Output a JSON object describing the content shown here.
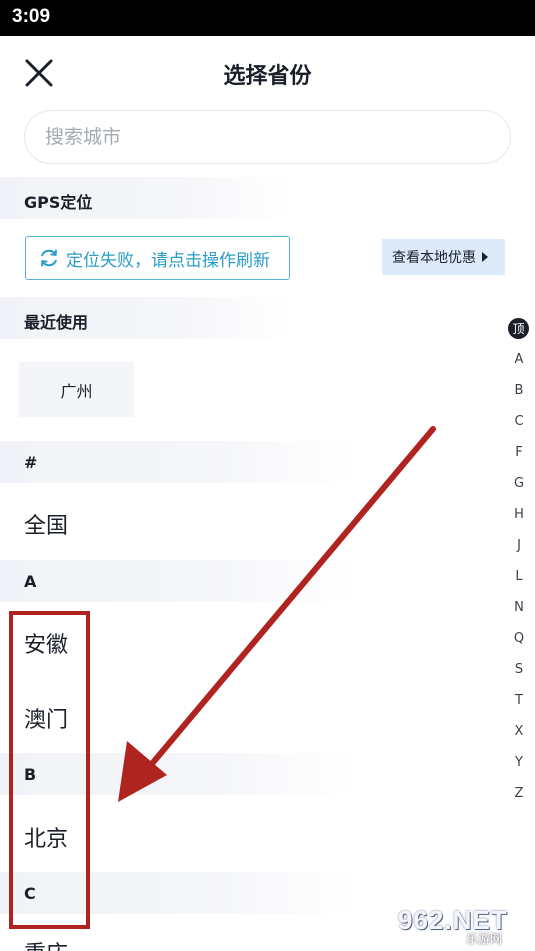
{
  "status_bar": {
    "time": "3:09"
  },
  "header": {
    "title": "选择省份"
  },
  "search": {
    "placeholder": "搜索城市"
  },
  "gps": {
    "section_label": "GPS定位",
    "refresh_text": "定位失败，请点击操作刷新",
    "local_offer_text": "查看本地优惠"
  },
  "recent": {
    "section_label": "最近使用",
    "chips": [
      "广州"
    ]
  },
  "sections": [
    {
      "label": "#",
      "items": [
        "全国"
      ]
    },
    {
      "label": "A",
      "items": [
        "安徽",
        "澳门"
      ]
    },
    {
      "label": "B",
      "items": [
        "北京"
      ]
    },
    {
      "label": "C",
      "items": [
        "重庆"
      ]
    }
  ],
  "alpha_index": {
    "top": "顶",
    "letters": [
      "A",
      "B",
      "C",
      "F",
      "G",
      "H",
      "J",
      "L",
      "N",
      "Q",
      "S",
      "T",
      "X",
      "Y",
      "Z"
    ]
  },
  "colors": {
    "accent": "#2a9cc7",
    "annotation": "#b0241f",
    "offer_bg": "#dbe9f8"
  },
  "watermark": {
    "main": "962.NET",
    "sub": "乐游网"
  }
}
